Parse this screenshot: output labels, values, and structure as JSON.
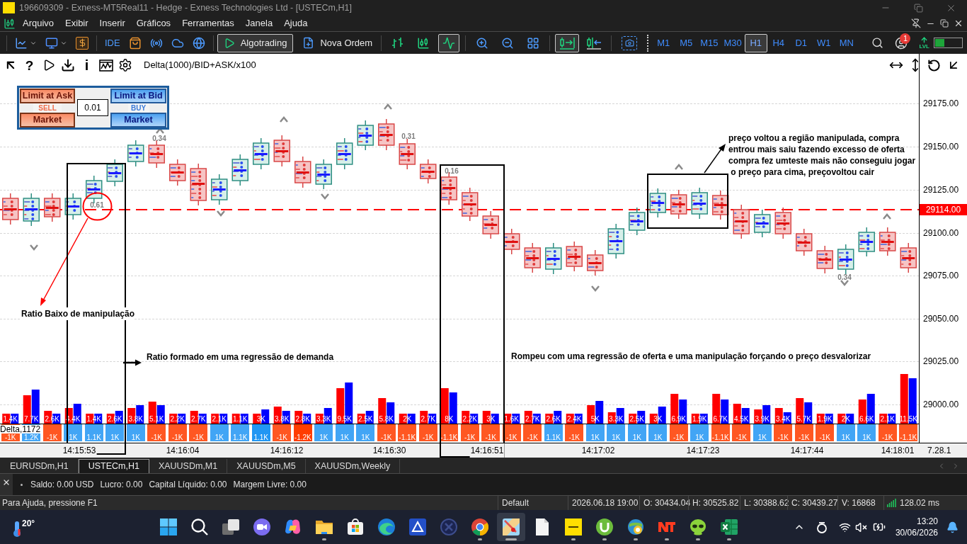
{
  "window": {
    "title": "196609309 - Exness-MT5Real11 - Hedge - Exness Technologies Ltd - [USTECm,H1]"
  },
  "menu": [
    "Arquivo",
    "Exibir",
    "Inserir",
    "Gráficos",
    "Ferramentas",
    "Janela",
    "Ajuda"
  ],
  "toolbar": {
    "ide": "IDE",
    "algotrading": {
      "label": "Algotrading",
      "on": true
    },
    "new_order": "Nova Ordem",
    "chart_types": [
      {
        "kind": "bars",
        "selected": false
      },
      {
        "kind": "candles",
        "selected": false
      },
      {
        "kind": "line",
        "selected": true
      }
    ],
    "chart_shift": {
      "selected": true
    },
    "auto_scroll": {
      "selected": false
    },
    "timeframes": [
      {
        "label": "M1",
        "selected": false
      },
      {
        "label": "M5",
        "selected": false
      },
      {
        "label": "M15",
        "selected": false
      },
      {
        "label": "M30",
        "selected": false
      },
      {
        "label": "H1",
        "selected": true
      },
      {
        "label": "H4",
        "selected": false
      },
      {
        "label": "D1",
        "selected": false
      },
      {
        "label": "W1",
        "selected": false
      },
      {
        "label": "MN",
        "selected": false
      }
    ],
    "notifications": "1",
    "lvl": "LVL",
    "meter": {
      "level": 0.36
    }
  },
  "chart": {
    "tool_glyphs": [
      "?",
      "i"
    ],
    "indicator": "Delta(1000)/BID+ASK/x100",
    "order_panel": {
      "sell_limit": "Limit at Ask",
      "sell": "SELL",
      "sell_market": "Market",
      "volume": "0.01",
      "buy_limit": "Limit at Bid",
      "buy": "BUY",
      "buy_market": "Market"
    },
    "price_axis": [
      "29175.00",
      "29150.00",
      "29125.00",
      "29100.00",
      "29075.00",
      "29050.00",
      "29025.00",
      "29000.00"
    ],
    "current_price": "29114.00",
    "ratios": [
      "0.61",
      "0.34",
      "0.31",
      "0.16",
      "0.34"
    ],
    "annotations": [
      "Ratio Baixo de manipulação",
      "Ratio formado em uma regressão de demanda",
      "Rompeu com uma regressão de oferta e uma manipulação forçando o preço desvalorizar",
      "preço voltou a região manipulada, compra\nentrou mais saiu fazendo excesso de oferta\ncompra fez umteste mais não conseguiu jogar\n o preço para cima, preçovoltou cair"
    ],
    "volume_columns": [
      {
        "volume": "1.4K",
        "delta": "-1K",
        "color": "#ff5722"
      },
      {
        "volume": "7.7K",
        "delta": "1.2K",
        "color": "#42a5f5"
      },
      {
        "volume": "2.6K",
        "delta": "-1K",
        "color": "#ff5722"
      },
      {
        "volume": "4.4K",
        "delta": "1K",
        "color": "#42a5f5"
      },
      {
        "volume": "1.4K",
        "delta": "1.1K",
        "color": "#42a5f5"
      },
      {
        "volume": "2.6K",
        "delta": "1K",
        "color": "#42a5f5"
      },
      {
        "volume": "3.8K",
        "delta": "1K",
        "color": "#42a5f5"
      },
      {
        "volume": "5.1K",
        "delta": "-1K",
        "color": "#ff5722"
      },
      {
        "volume": "2.2K",
        "delta": "-1K",
        "color": "#ff5722"
      },
      {
        "volume": "2.7K",
        "delta": "-1K",
        "color": "#ff5722"
      },
      {
        "volume": "2.1K",
        "delta": "1K",
        "color": "#42a5f5"
      },
      {
        "volume": "1.1K",
        "delta": "1.1K",
        "color": "#42a5f5"
      },
      {
        "volume": "3K",
        "delta": "1.1K",
        "color": "#2196f3"
      },
      {
        "volume": "3.8K",
        "delta": "-1K",
        "color": "#ff5722"
      },
      {
        "volume": "2.8K",
        "delta": "-1.2K",
        "color": "#ff3d00"
      },
      {
        "volume": "3.3K",
        "delta": "1K",
        "color": "#42a5f5"
      },
      {
        "volume": "9.5K",
        "delta": "1K",
        "color": "#42a5f5"
      },
      {
        "volume": "2.5K",
        "delta": "1K",
        "color": "#42a5f5"
      },
      {
        "volume": "5.8K",
        "delta": "-1K",
        "color": "#ff5722"
      },
      {
        "volume": "2K",
        "delta": "-1.1K",
        "color": "#ff5722"
      },
      {
        "volume": "2.7K",
        "delta": "-1K",
        "color": "#ff5722"
      },
      {
        "volume": "8K",
        "delta": "-1.1K",
        "color": "#ff5722"
      },
      {
        "volume": "2.2K",
        "delta": "-1K",
        "color": "#ff5722"
      },
      {
        "volume": "3K",
        "delta": "-1K",
        "color": "#ff5722"
      },
      {
        "volume": "1.6K",
        "delta": "-1K",
        "color": "#ff5722"
      },
      {
        "volume": "2.7K",
        "delta": "-1K",
        "color": "#ff5722"
      },
      {
        "volume": "2.6K",
        "delta": "1.1K",
        "color": "#42a5f5"
      },
      {
        "volume": "2.4K",
        "delta": "-1K",
        "color": "#ff5722"
      },
      {
        "volume": "5K",
        "delta": "1K",
        "color": "#42a5f5"
      },
      {
        "volume": "3.3K",
        "delta": "1K",
        "color": "#42a5f5"
      },
      {
        "volume": "2.5K",
        "delta": "1K",
        "color": "#42a5f5"
      },
      {
        "volume": "3K",
        "delta": "1K",
        "color": "#42a5f5"
      },
      {
        "volume": "6.9K",
        "delta": "-1K",
        "color": "#ff5722"
      },
      {
        "volume": "1.9K",
        "delta": "1K",
        "color": "#42a5f5"
      },
      {
        "volume": "6.7K",
        "delta": "-1.1K",
        "color": "#ff5722"
      },
      {
        "volume": "4.5K",
        "delta": "-1K",
        "color": "#ff5722"
      },
      {
        "volume": "3.9K",
        "delta": "1K",
        "color": "#42a5f5"
      },
      {
        "volume": "3.4K",
        "delta": "-1K",
        "color": "#ff5722"
      },
      {
        "volume": "5.7K",
        "delta": "-1K",
        "color": "#ff5722"
      },
      {
        "volume": "1.9K",
        "delta": "-1K",
        "color": "#ff5722"
      },
      {
        "volume": "2K",
        "delta": "1K",
        "color": "#42a5f5"
      },
      {
        "volume": "6.6K",
        "delta": "1K",
        "color": "#42a5f5"
      },
      {
        "volume": "2.1K",
        "delta": "-1K",
        "color": "#ff5722"
      },
      {
        "volume": "11.5K",
        "delta": "-1.1K",
        "color": "#ff5722"
      }
    ],
    "delta_label": "Delta,1172",
    "time_axis": [
      "14:15:53",
      "14:16:04",
      "14:16:12",
      "14:16:30",
      "14:16:51",
      "14:17:02",
      "14:17:23",
      "14:17:44",
      "14:18:01"
    ],
    "version": "7.28.1"
  },
  "chart_tabs": [
    {
      "label": "EURUSDm,H1",
      "selected": false
    },
    {
      "label": "USTECm,H1",
      "selected": true
    },
    {
      "label": "XAUUSDm,M1",
      "selected": false
    },
    {
      "label": "XAUUSDm,M5",
      "selected": false
    },
    {
      "label": "XAUUSDm,Weekly",
      "selected": false
    }
  ],
  "account": [
    "Saldo: 0.00 USD",
    "Lucro: 0.00",
    "Capital Líquido: 0.00",
    "Margem Livre: 0.00"
  ],
  "status_bar": {
    "help": "Para Ajuda, pressione F1",
    "cells": [
      "Default",
      "2026.06.18 19:00",
      "O: 30434.04",
      "H: 30525.82",
      "L: 30388.62",
      "C: 30439.27",
      "V: 16868"
    ],
    "latency": "128.02 ms"
  },
  "taskbar": {
    "weather": "20°",
    "apps": [
      {
        "kind": "start",
        "running": false,
        "selected": false
      },
      {
        "kind": "search",
        "running": false,
        "selected": false
      },
      {
        "kind": "task_view",
        "running": false,
        "selected": false
      },
      {
        "kind": "video_chat",
        "running": false,
        "selected": false
      },
      {
        "kind": "assistant",
        "running": false,
        "selected": false
      },
      {
        "kind": "folder",
        "running": true,
        "selected": false
      },
      {
        "kind": "store",
        "running": false,
        "selected": false
      },
      {
        "kind": "browser_wave",
        "running": false,
        "selected": false
      },
      {
        "kind": "scanner",
        "running": false,
        "selected": false
      },
      {
        "kind": "disc",
        "running": false,
        "selected": false
      },
      {
        "kind": "browser_ring",
        "running": true,
        "selected": false
      },
      {
        "kind": "map",
        "running": true,
        "selected": true
      },
      {
        "kind": "document",
        "running": false,
        "selected": false
      },
      {
        "kind": "yellow_tile",
        "running": true,
        "selected": false
      },
      {
        "kind": "torrent",
        "running": true,
        "selected": false
      },
      {
        "kind": "platform",
        "running": true,
        "selected": false
      },
      {
        "kind": "red_logo",
        "running": true,
        "selected": false
      },
      {
        "kind": "alien",
        "running": true,
        "selected": false
      },
      {
        "kind": "spreadsheet",
        "running": true,
        "selected": false
      }
    ],
    "clock": {
      "time": "13:20",
      "date": "30/06/2026"
    }
  }
}
